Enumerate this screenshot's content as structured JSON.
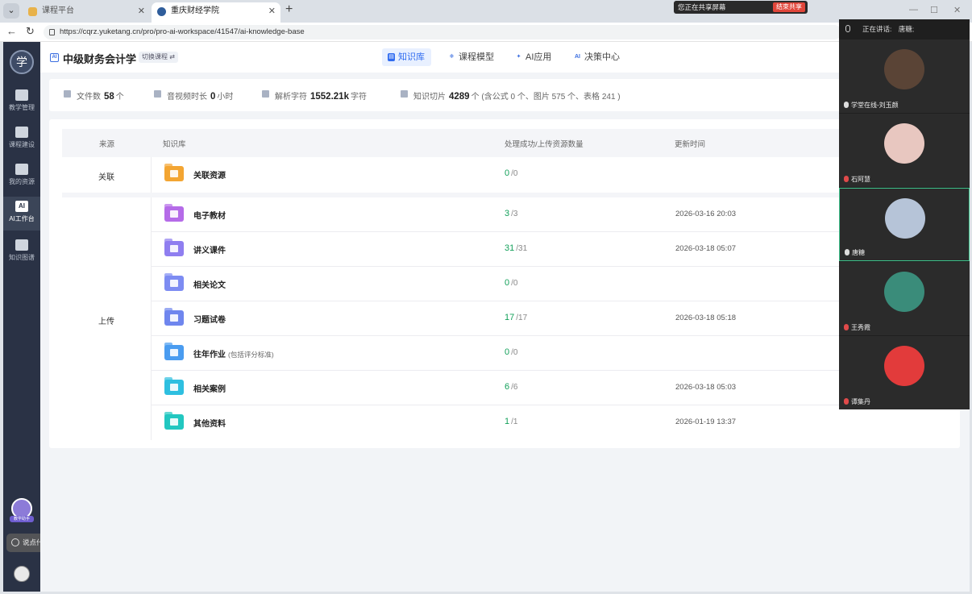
{
  "browser": {
    "tabs": [
      {
        "title": "课程平台",
        "active": false
      },
      {
        "title": "重庆财经学院",
        "active": true
      }
    ],
    "url": "https://cqrz.yuketang.cn/pro/pro-ai-workspace/41547/ai-knowledge-base"
  },
  "screen_share": {
    "status": "您正在共享屏幕",
    "end_label": "结束共享"
  },
  "sidebar": {
    "logo": "学",
    "items": [
      {
        "label": "教学管理",
        "icon": "teaching-icon"
      },
      {
        "label": "课程建设",
        "icon": "book-icon"
      },
      {
        "label": "我的资源",
        "icon": "box-icon"
      },
      {
        "label": "AI工作台",
        "icon": "ai-icon",
        "active": true
      },
      {
        "label": "知识图谱",
        "icon": "graph-icon"
      }
    ],
    "assistant_label": "教学助手",
    "chat_placeholder": "说点什么..."
  },
  "course": {
    "title": "中级财务会计学",
    "switch_label": "切换课程 ⇄"
  },
  "top_tabs": [
    {
      "label": "知识库",
      "active": true
    },
    {
      "label": "课程模型",
      "active": false
    },
    {
      "label": "AI应用",
      "active": false
    },
    {
      "label": "决策中心",
      "active": false
    }
  ],
  "stats": {
    "files": {
      "label": "文件数",
      "value": "58",
      "unit": "个"
    },
    "av": {
      "label": "音视频时长",
      "value": "0",
      "unit": "小时"
    },
    "chars": {
      "label": "解析字符",
      "value": "1552.21k",
      "unit": "字符"
    },
    "slices": {
      "label": "知识切片",
      "value": "4289",
      "unit": "个 (含公式 0 个、图片 575 个、表格 241 )"
    }
  },
  "table": {
    "headers": {
      "source": "来源",
      "kb": "知识库",
      "count": "处理成功/上传资源数量",
      "time": "更新时间"
    },
    "groups": {
      "linked": "关联",
      "upload": "上传"
    },
    "rows": [
      {
        "name": "关联资源",
        "note": "",
        "ok": "0",
        "total": "/0",
        "time": "",
        "color": "#f3a532"
      },
      {
        "name": "电子教材",
        "note": "",
        "ok": "3",
        "total": "/3",
        "time": "2026-03-16 20:03",
        "color": "#b56be8"
      },
      {
        "name": "讲义课件",
        "note": "",
        "ok": "31",
        "total": "/31",
        "time": "2026-03-18 05:07",
        "color": "#8f7ef0"
      },
      {
        "name": "相关论文",
        "note": "",
        "ok": "0",
        "total": "/0",
        "time": "",
        "color": "#7d8cf2"
      },
      {
        "name": "习题试卷",
        "note": "",
        "ok": "17",
        "total": "/17",
        "time": "2026-03-18 05:18",
        "color": "#6f86ee"
      },
      {
        "name": "往年作业",
        "note": "(包括评分标准)",
        "ok": "0",
        "total": "/0",
        "time": "",
        "color": "#4a9cf0"
      },
      {
        "name": "相关案例",
        "note": "",
        "ok": "6",
        "total": "/6",
        "time": "2026-03-18 05:03",
        "color": "#2ebfe0"
      },
      {
        "name": "其他资料",
        "note": "",
        "ok": "1",
        "total": "/1",
        "time": "2026-01-19 13:37",
        "color": "#22c7c0"
      }
    ]
  },
  "meeting": {
    "speaking_label": "正在讲话:",
    "speaker": "唐糖;",
    "participants": [
      {
        "name": "学堂在线-刘玉颜",
        "color": "#5a4436",
        "muted": false
      },
      {
        "name": "石阿慧",
        "color": "#e8c7c0",
        "muted": true
      },
      {
        "name": "唐糖",
        "color": "#b6c4d8",
        "muted": false,
        "active": true
      },
      {
        "name": "王秀霞",
        "color": "#3a8c7a",
        "muted": true
      },
      {
        "name": "谭集丹",
        "color": "#e23b3b",
        "muted": true
      }
    ]
  }
}
